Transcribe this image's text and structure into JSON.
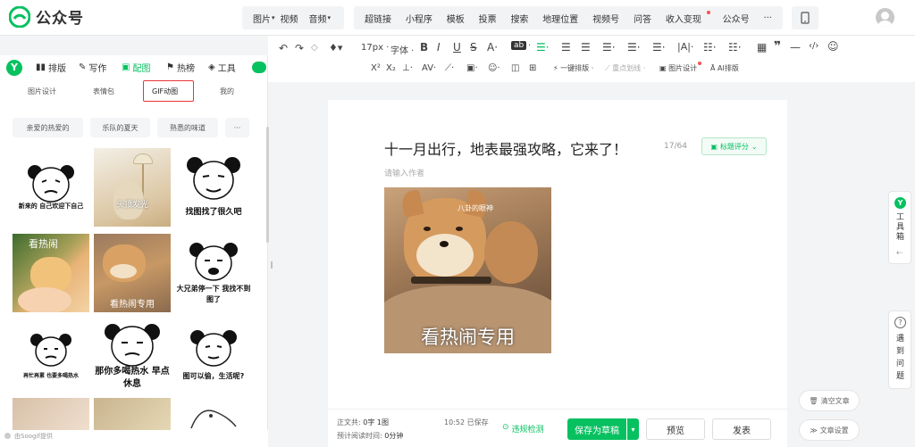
{
  "topbar": {
    "brand": "公众号",
    "group1": [
      "图片",
      "视频",
      "音频"
    ],
    "group2": [
      "超链接",
      "小程序",
      "模板",
      "投票",
      "搜索",
      "地理位置",
      "视频号",
      "问答",
      "收入变现",
      "公众号"
    ],
    "more": "···"
  },
  "format": {
    "row1": {
      "font_size": "17px",
      "font": "字体"
    },
    "row2": {
      "one_click": "一键排版",
      "key_line": "重点划线",
      "image_design": "图片设计",
      "ai_layout": "AI排版"
    }
  },
  "left": {
    "tabs": [
      "排版",
      "写作",
      "配图",
      "热榜",
      "工具"
    ],
    "subtabs": [
      "图片设计",
      "表情包",
      "GIF动图",
      "我的"
    ],
    "chips": [
      "亲爱的热爱的",
      "乐队的夏天",
      "熟悉的味道",
      "···"
    ],
    "gifs": [
      {
        "caption": "新来的 自己欢迎下自己"
      },
      {
        "caption": "头顶发光"
      },
      {
        "caption": "找图找了很久吧"
      },
      {
        "caption": "看热闹"
      },
      {
        "caption": "看热闹专用"
      },
      {
        "caption": "大兄弟停一下 我找不到图了"
      },
      {
        "caption": "再忙再累 也要多喝热水"
      },
      {
        "caption": "那你多喝热水 早点休息"
      },
      {
        "caption": "图可以偷，生活呢?"
      }
    ],
    "footer": "由Soogif提供"
  },
  "editor": {
    "title": "十一月出行，地表最强攻略，它来了！",
    "title_count": "17/64",
    "title_score": "标题评分",
    "author_placeholder": "请输入作者",
    "image_watermark": "八卦的眼神",
    "image_caption": "看热闹专用"
  },
  "bottom": {
    "word_count_label": "正文共:",
    "word_count_value": "0字 1图",
    "read_time_label": "预计阅读时间:",
    "read_time_value": "0分钟",
    "saved": "10:52 已保存",
    "violation_check": "违规检测",
    "save_draft": "保存为草稿",
    "preview": "预览",
    "publish": "发表"
  },
  "right": {
    "toolbox": [
      "工",
      "具",
      "箱"
    ],
    "help": [
      "遇",
      "到",
      "问",
      "题"
    ],
    "clear": "清空文章",
    "settings": "文章设置"
  }
}
